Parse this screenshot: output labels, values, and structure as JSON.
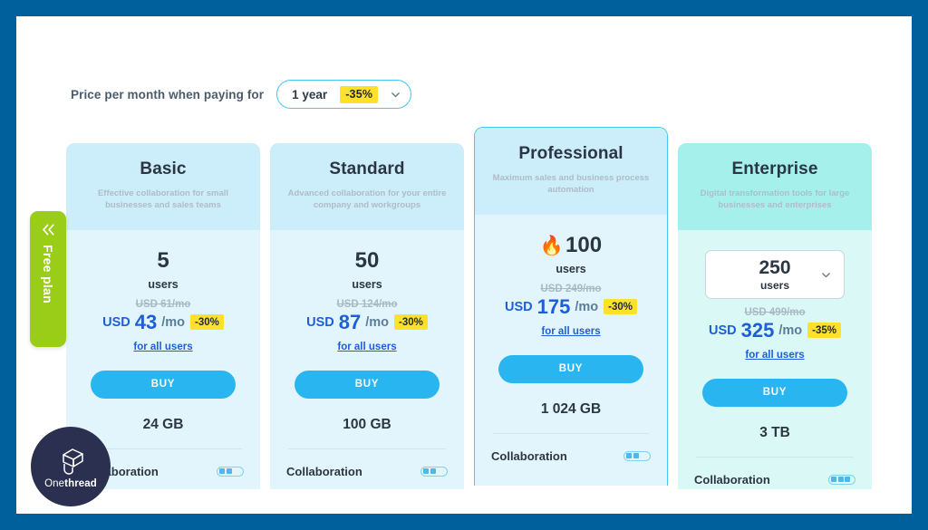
{
  "control": {
    "label": "Price per month when paying for",
    "period_value": "1 year",
    "period_badge": "-35%",
    "chevron_icon": "chevron-down-icon"
  },
  "free_tab": {
    "label": "Free plan",
    "icon": "double-chevron-left-icon"
  },
  "plans": [
    {
      "name": "Basic",
      "description": "Effective collaboration for small businesses and sales teams",
      "seats": "5",
      "seats_label": "users",
      "has_flame": false,
      "is_select": false,
      "old_price": "USD 61/mo",
      "currency": "USD",
      "amount": "43",
      "per": "/mo",
      "discount": "-30%",
      "all_users_link": "for all users",
      "buy_label": "BUY",
      "storage": "24 GB",
      "feature_name": "Collaboration",
      "feature_level": 2,
      "featured": false
    },
    {
      "name": "Standard",
      "description": "Advanced collaboration for your entire company and workgroups",
      "seats": "50",
      "seats_label": "users",
      "has_flame": false,
      "is_select": false,
      "old_price": "USD 124/mo",
      "currency": "USD",
      "amount": "87",
      "per": "/mo",
      "discount": "-30%",
      "all_users_link": "for all users",
      "buy_label": "BUY",
      "storage": "100 GB",
      "feature_name": "Collaboration",
      "feature_level": 2,
      "featured": false
    },
    {
      "name": "Professional",
      "description": "Maximum sales and business process automation",
      "seats": "100",
      "seats_label": "users",
      "has_flame": true,
      "flame_icon": "flame-icon",
      "is_select": false,
      "old_price": "USD 249/mo",
      "currency": "USD",
      "amount": "175",
      "per": "/mo",
      "discount": "-30%",
      "all_users_link": "for all users",
      "buy_label": "BUY",
      "storage": "1 024 GB",
      "feature_name": "Collaboration",
      "feature_level": 2,
      "featured": true
    },
    {
      "name": "Enterprise",
      "description": "Digital transformation tools for large businesses and enterprises",
      "seats": "250",
      "seats_label": "users",
      "has_flame": false,
      "is_select": true,
      "select_icon": "chevron-down-icon",
      "old_price": "USD 499/mo",
      "currency": "USD",
      "amount": "325",
      "per": "/mo",
      "discount": "-35%",
      "all_users_link": "for all users",
      "buy_label": "BUY",
      "storage": "3 TB",
      "feature_name": "Collaboration",
      "feature_level": 3,
      "featured": false
    }
  ],
  "logo": {
    "name_light": "One",
    "name_bold": "thread",
    "mark_icon": "onethread-spool-icon"
  },
  "colors": {
    "frame_blue": "#00609C",
    "accent_cyan": "#46C6F2",
    "buy_blue": "#29B6F0",
    "price_blue": "#1E5FD8",
    "badge_yellow": "#FFE02B",
    "free_green": "#9ACD18",
    "card_head_blue": "#CCEDFA",
    "card_body_blue": "#E3F5FC",
    "enterprise_head": "#A6F0EC",
    "enterprise_body": "#DAF8F6",
    "logo_navy": "#2C3050"
  }
}
